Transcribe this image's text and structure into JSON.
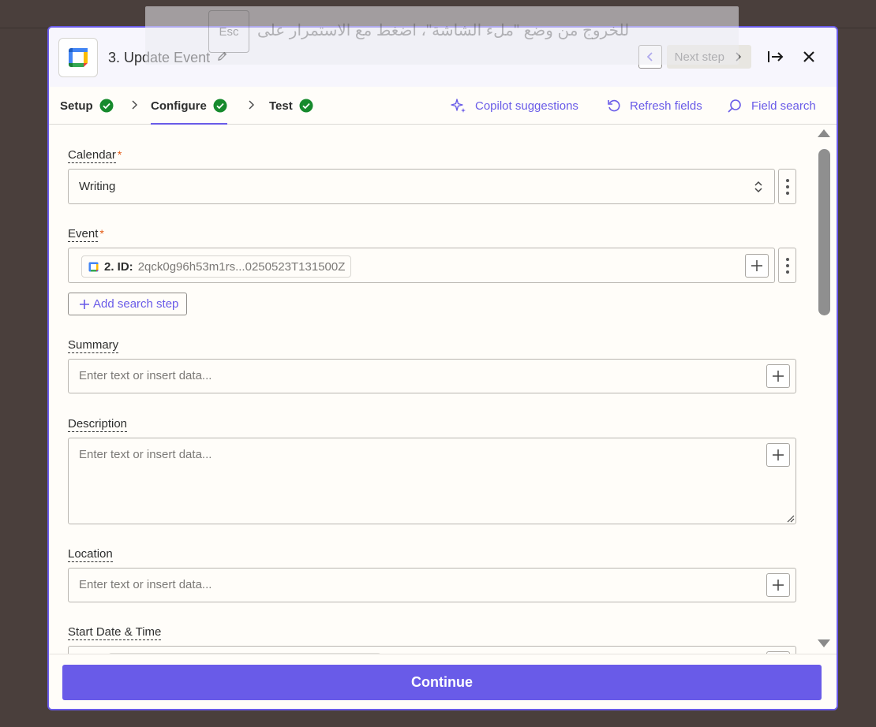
{
  "overlay": {
    "esc_key": "Esc",
    "message": "للخروج من وضع \"ملء الشاشة\"، اضغط مع الاستمرار على"
  },
  "header": {
    "title": "3. Update Event",
    "next_step": "Next step"
  },
  "tabs": [
    {
      "label": "Setup",
      "complete": true
    },
    {
      "label": "Configure",
      "complete": true,
      "active": true
    },
    {
      "label": "Test",
      "complete": true
    }
  ],
  "toolbar": {
    "copilot": "Copilot suggestions",
    "refresh": "Refresh fields",
    "field_search": "Field search"
  },
  "fields": {
    "calendar": {
      "label": "Calendar",
      "required": "*",
      "value": "Writing"
    },
    "event": {
      "label": "Event",
      "required": "*",
      "chip_step": "2. ID:",
      "chip_value": "2qck0g96h53m1rs...0250523T131500Z"
    },
    "add_search_step": "Add search step",
    "summary": {
      "label": "Summary",
      "placeholder": "Enter text or insert data..."
    },
    "description": {
      "label": "Description",
      "placeholder": "Enter text or insert data..."
    },
    "location": {
      "label": "Location",
      "placeholder": "Enter text or insert data..."
    },
    "start": {
      "label": "Start Date & Time"
    }
  },
  "footer": {
    "continue": "Continue"
  },
  "colors": {
    "accent": "#695be8",
    "success": "#168a2d",
    "required": "#e45a13"
  }
}
